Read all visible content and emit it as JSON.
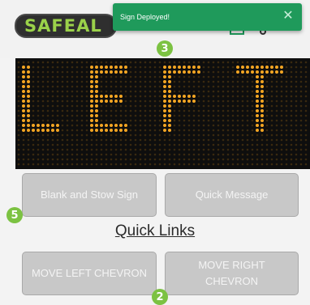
{
  "header": {
    "logo_text": "SAFEAL",
    "icons": [
      "green-icon",
      "status-icon"
    ]
  },
  "toast": {
    "message": "Sign Deployed!",
    "close_glyph": "✕",
    "color": "#1f9a5b"
  },
  "sign_board": {
    "message": "LEFT",
    "led_color": "#f4a623",
    "background": "#0e0e0e"
  },
  "buttons": {
    "blank_and_stow": "Blank and Stow Sign",
    "quick_message": "Quick Message"
  },
  "quick_links": {
    "title": "Quick Links",
    "move_left_chevron": "MOVE LEFT CHEVRON",
    "move_right_chevron": "MOVE RIGHT CHEVRON"
  },
  "annotations": {
    "step_3": "3",
    "step_5": "5",
    "step_2": "2",
    "color": "#7cc242"
  }
}
